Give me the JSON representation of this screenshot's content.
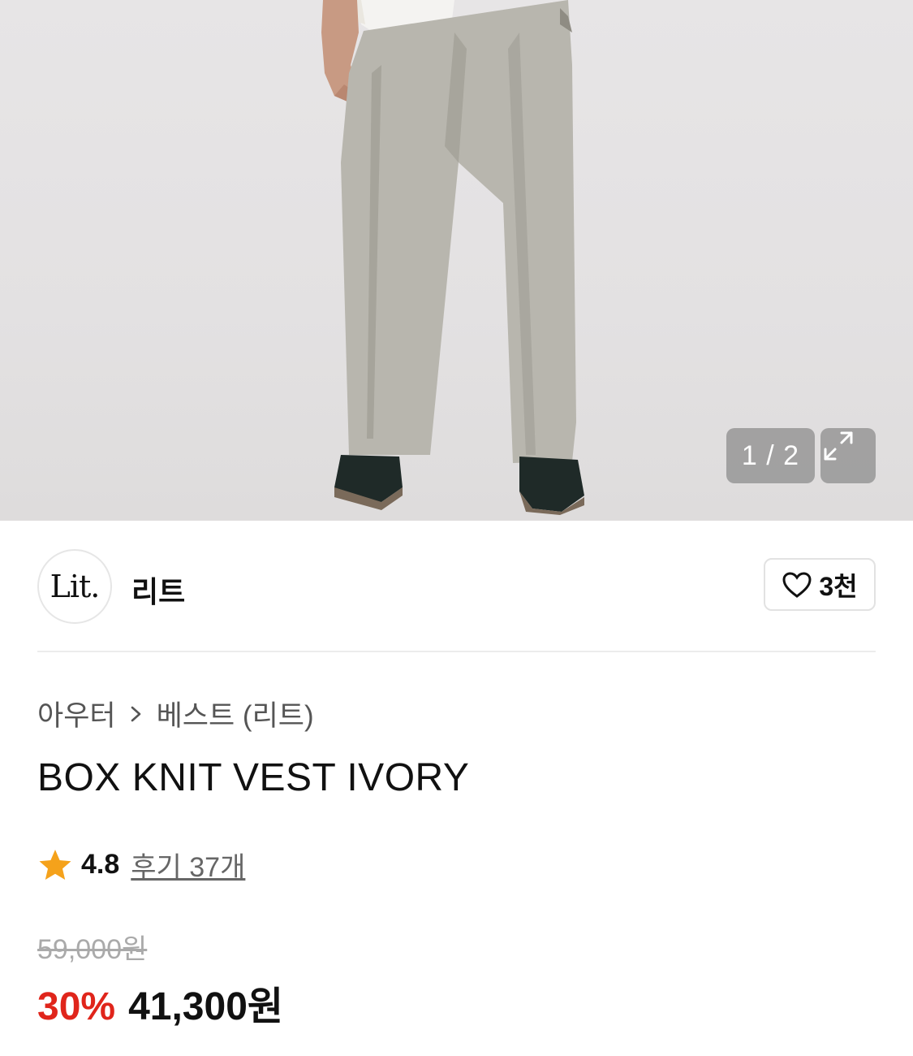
{
  "gallery": {
    "counter": "1 / 2",
    "current_index": 1,
    "total": 2,
    "expand_icon": "expand-icon"
  },
  "brand": {
    "logo_text": "Lit.",
    "name": "리트",
    "like_icon": "heart-icon",
    "like_count": "3천"
  },
  "breadcrumb": {
    "category": "아우터",
    "separator_icon": "chevron-right-icon",
    "subcategory": "베스트 (리트)"
  },
  "product": {
    "title": "BOX KNIT VEST IVORY",
    "rating_icon": "star-icon",
    "rating": "4.8",
    "reviews": "후기 37개",
    "original_price": "59,000원",
    "discount": "30%",
    "sale_price": "41,300원"
  },
  "colors": {
    "discount": "#e0251b",
    "star": "#f5a21b",
    "text": "#111111"
  }
}
